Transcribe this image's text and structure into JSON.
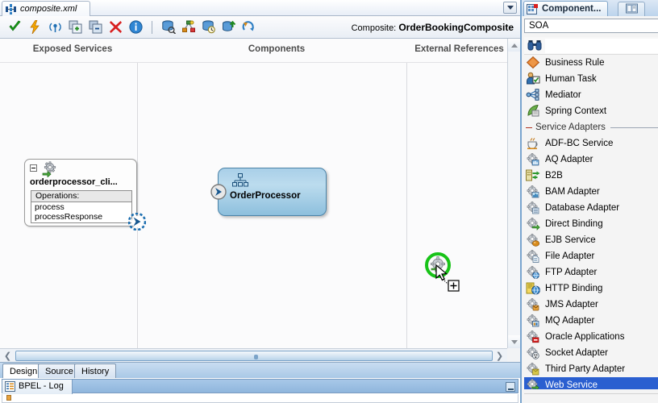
{
  "window": {
    "document_tab": "composite.xml",
    "document_tab_icon": "composite-xml-icon",
    "tab_dropdown_icon": "chevron-down-icon"
  },
  "toolbar": {
    "buttons": [
      {
        "name": "validate-button",
        "icon": "green-check-icon"
      },
      {
        "name": "run-button",
        "icon": "lightning-bolt-icon"
      },
      {
        "name": "antenna-button",
        "icon": "antenna-icon"
      },
      {
        "name": "add-button",
        "icon": "add-copy-icon"
      },
      {
        "name": "remove-button",
        "icon": "remove-copy-icon"
      },
      {
        "name": "delete-button",
        "icon": "red-x-icon"
      },
      {
        "name": "info-button",
        "icon": "info-circle-icon"
      },
      {
        "name": "separator",
        "icon": "separator"
      },
      {
        "name": "deploy-button",
        "icon": "database-deploy-icon"
      },
      {
        "name": "topology-button",
        "icon": "topology-icon"
      },
      {
        "name": "history-button",
        "icon": "clock-database-icon"
      },
      {
        "name": "export-button",
        "icon": "export-up-icon"
      },
      {
        "name": "refresh-button",
        "icon": "refresh-arrow-icon"
      }
    ],
    "composite_prefix": "Composite:",
    "composite_name": "OrderBookingComposite"
  },
  "canvas": {
    "columns": {
      "exposed_services": "Exposed Services",
      "components": "Components",
      "external_references": "External References"
    },
    "exposed_service": {
      "name": "orderprocessor_cli...",
      "icon": "service-gear-icon",
      "expand_icon": "collapse-minus-icon",
      "operations_label": "Operations:",
      "operations": [
        "process",
        "processResponse"
      ],
      "connector_icon": "wire-connector-icon"
    },
    "component": {
      "name": "OrderProcessor",
      "icon": "bpel-process-icon",
      "port_icon": "component-port-icon",
      "fill_top": "#a9cfe8",
      "fill_bottom": "#8dbfdd",
      "border": "#4a83a8"
    },
    "drop_target": {
      "icon": "web-service-drop-icon",
      "ring_color": "#18c318",
      "cursor_icon": "drag-copy-cursor"
    },
    "vscroll": {
      "up_icon": "scroll-up-arrow-icon",
      "down_icon": "scroll-down-arrow-icon"
    },
    "hscroll": {
      "left_icon": "scroll-left-arrow-icon",
      "right_icon": "scroll-right-arrow-icon"
    }
  },
  "editor_tabs": [
    {
      "label": "Design",
      "active": true
    },
    {
      "label": "Source",
      "active": false
    },
    {
      "label": "History",
      "active": false
    }
  ],
  "log": {
    "tab_label": "BPEL - Log",
    "tab_icon": "log-lines-icon",
    "minimize_icon": "minimize-icon"
  },
  "palette": {
    "tab_label": "Component...",
    "tab_icon": "component-palette-icon",
    "tab2_icon": "resource-catalog-icon",
    "selected_category": "SOA",
    "search_icon": "binoculars-search-icon",
    "search_value": "",
    "search_placeholder": "",
    "selection_color": "#2a5fd0",
    "items": [
      {
        "label": "Business Rule",
        "icon": "business-rule-icon",
        "type": "item",
        "selected": false
      },
      {
        "label": "Human Task",
        "icon": "human-task-icon",
        "type": "item",
        "selected": false
      },
      {
        "label": "Mediator",
        "icon": "mediator-icon",
        "type": "item",
        "selected": false
      },
      {
        "label": "Spring Context",
        "icon": "spring-context-icon",
        "type": "item",
        "selected": false
      },
      {
        "label": "Service Adapters",
        "icon": "",
        "type": "separator",
        "selected": false
      },
      {
        "label": "ADF-BC Service",
        "icon": "adf-bc-service-icon",
        "type": "item",
        "selected": false
      },
      {
        "label": "AQ Adapter",
        "icon": "aq-adapter-icon",
        "type": "item",
        "selected": false
      },
      {
        "label": "B2B",
        "icon": "b2b-icon",
        "type": "item",
        "selected": false
      },
      {
        "label": "BAM Adapter",
        "icon": "bam-adapter-icon",
        "type": "item",
        "selected": false
      },
      {
        "label": "Database Adapter",
        "icon": "database-adapter-icon",
        "type": "item",
        "selected": false
      },
      {
        "label": "Direct Binding",
        "icon": "direct-binding-icon",
        "type": "item",
        "selected": false
      },
      {
        "label": "EJB Service",
        "icon": "ejb-service-icon",
        "type": "item",
        "selected": false
      },
      {
        "label": "File Adapter",
        "icon": "file-adapter-icon",
        "type": "item",
        "selected": false
      },
      {
        "label": "FTP Adapter",
        "icon": "ftp-adapter-icon",
        "type": "item",
        "selected": false
      },
      {
        "label": "HTTP Binding",
        "icon": "http-binding-icon",
        "type": "item",
        "selected": false
      },
      {
        "label": "JMS Adapter",
        "icon": "jms-adapter-icon",
        "type": "item",
        "selected": false
      },
      {
        "label": "MQ Adapter",
        "icon": "mq-adapter-icon",
        "type": "item",
        "selected": false
      },
      {
        "label": "Oracle Applications",
        "icon": "oracle-applications-icon",
        "type": "item",
        "selected": false
      },
      {
        "label": "Socket Adapter",
        "icon": "socket-adapter-icon",
        "type": "item",
        "selected": false
      },
      {
        "label": "Third Party Adapter",
        "icon": "third-party-adapter-icon",
        "type": "item",
        "selected": false
      },
      {
        "label": "Web Service",
        "icon": "web-service-icon",
        "type": "item",
        "selected": true
      }
    ]
  }
}
